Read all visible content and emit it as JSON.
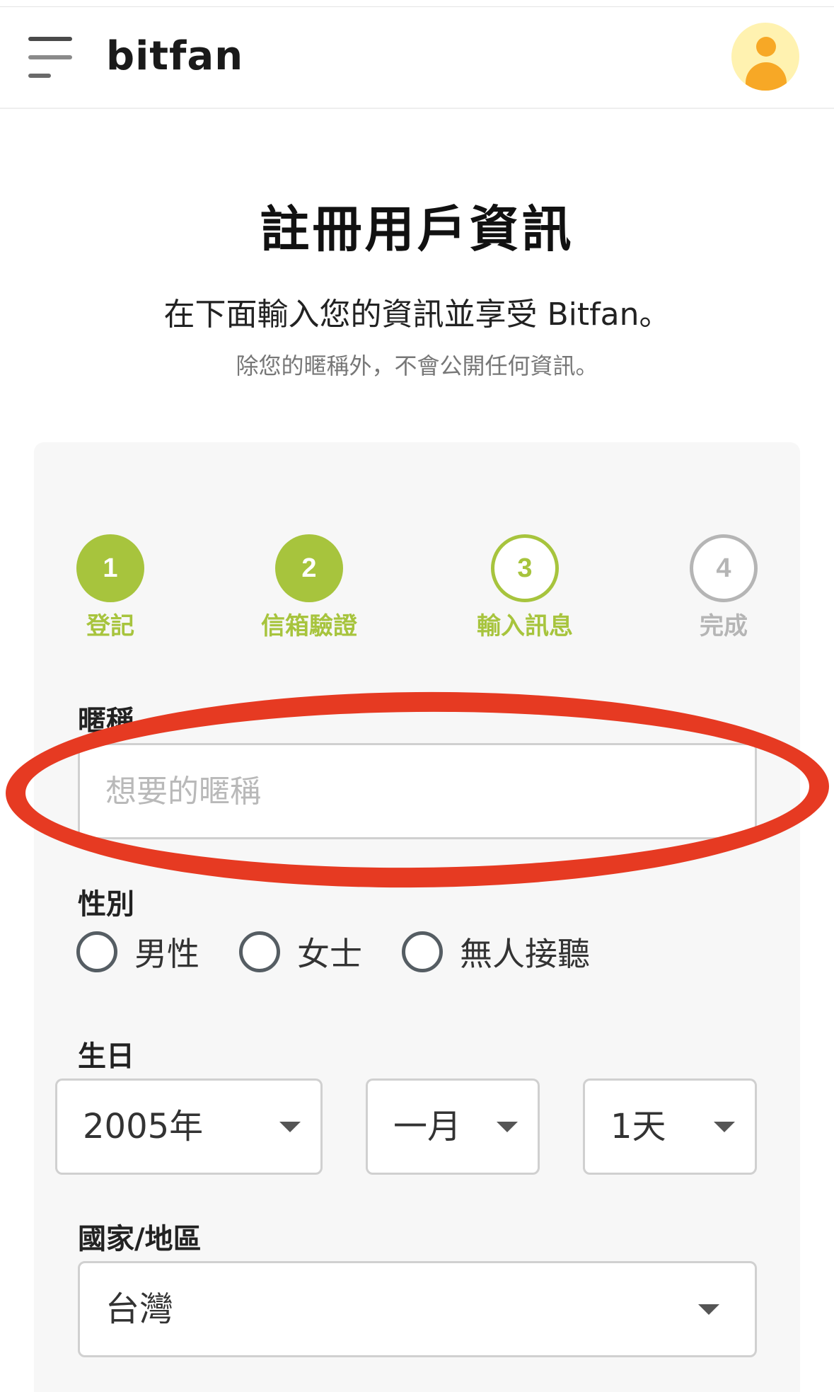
{
  "header": {
    "logo": "bitfan",
    "menu_icon": "hamburger-menu-icon",
    "avatar_icon": "user-avatar-icon"
  },
  "page": {
    "title": "註冊用戶資訊",
    "subtitle": "在下面輸入您的資訊並享受 Bitfan。",
    "note": "除您的暱稱外，不會公開任何資訊。"
  },
  "steps": [
    {
      "number": "1",
      "label": "登記",
      "state": "done"
    },
    {
      "number": "2",
      "label": "信箱驗證",
      "state": "done"
    },
    {
      "number": "3",
      "label": "輸入訊息",
      "state": "current"
    },
    {
      "number": "4",
      "label": "完成",
      "state": "todo"
    }
  ],
  "form": {
    "nickname": {
      "label": "暱稱",
      "placeholder": "想要的暱稱",
      "value": ""
    },
    "gender": {
      "label": "性別",
      "options": [
        "男性",
        "女士",
        "無人接聽"
      ]
    },
    "birthday": {
      "label": "生日",
      "year": "2005年",
      "month": "一月",
      "day": "1天"
    },
    "country": {
      "label": "國家/地區",
      "value": "台灣"
    }
  },
  "colors": {
    "accent": "#a7c43d",
    "highlight": "#e63a22",
    "inactive": "#b5b5b5",
    "avatar": "#f7a826"
  }
}
